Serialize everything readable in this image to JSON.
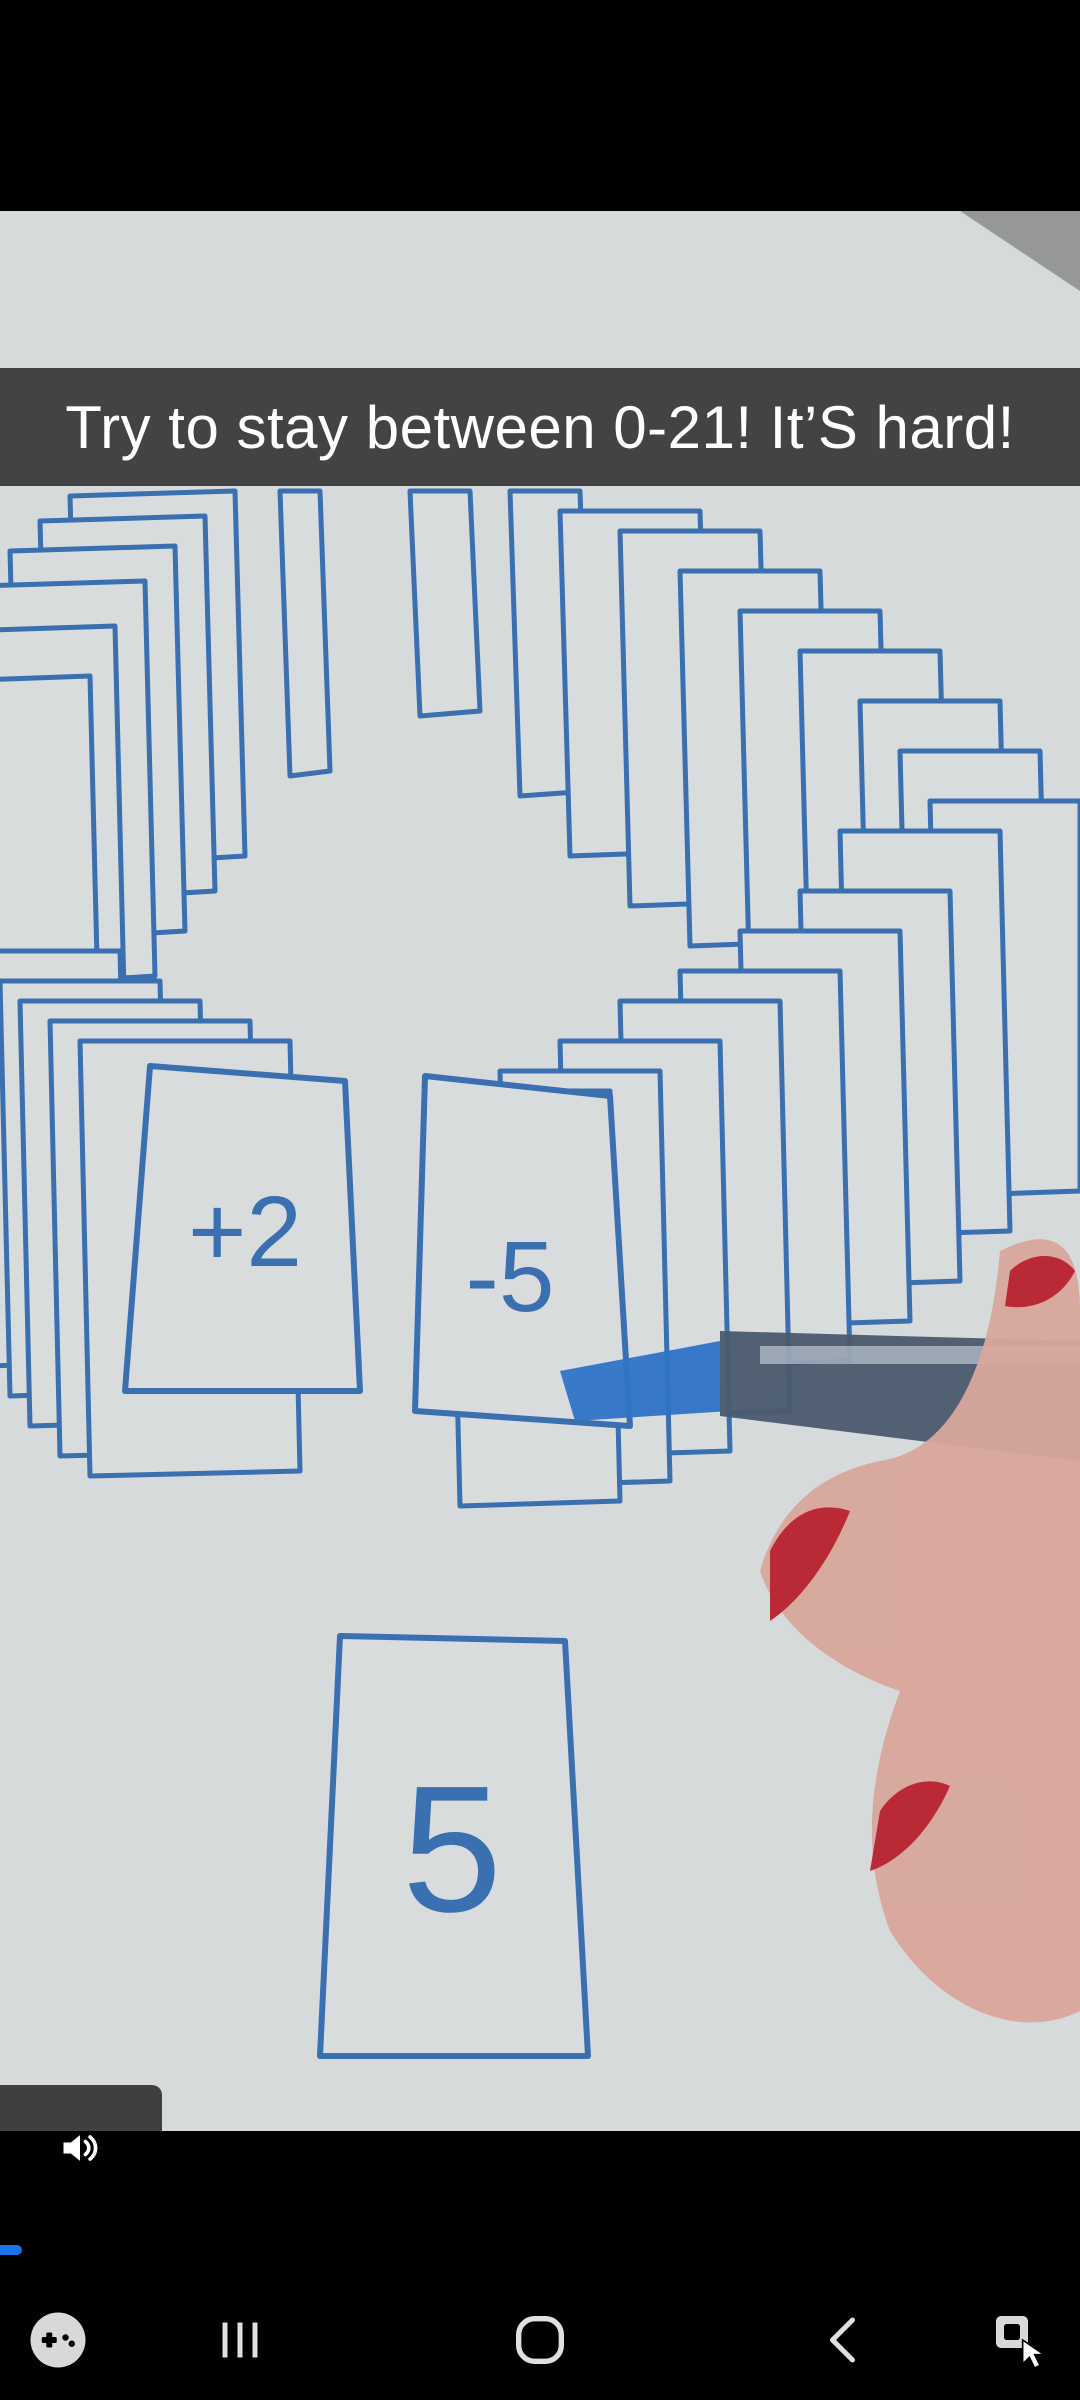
{
  "video": {
    "caption": "Try to stay between 0-21! It’S hard!",
    "cards": {
      "left_card": "+2",
      "right_card": "-5",
      "center_card": "5"
    },
    "progress_fraction": 0.02
  },
  "colors": {
    "ink": "#3a6fb0",
    "progress": "#1a73e8",
    "caption_bg": "#3c3c3c"
  },
  "icons": {
    "volume": "volume-icon",
    "game": "game-controller-icon",
    "recents": "recent-apps-icon",
    "home": "home-icon",
    "back": "back-icon",
    "accessibility": "accessibility-pointer-icon"
  }
}
